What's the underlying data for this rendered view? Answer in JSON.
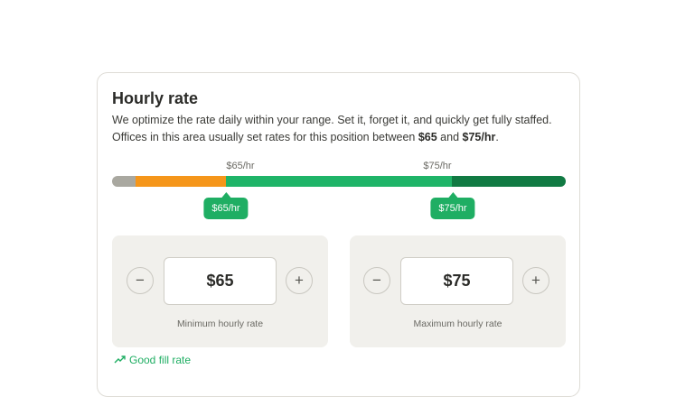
{
  "card": {
    "title": "Hourly rate",
    "desc_line1": "We optimize the rate daily within your range. Set it, forget it, and quickly get fully staffed.",
    "desc_line2_prefix": "Offices in this area usually set rates for this position between ",
    "desc_low": "$65",
    "desc_and": " and ",
    "desc_high": "$75/hr",
    "desc_end": "."
  },
  "range": {
    "tick_low": "$65/hr",
    "tick_high": "$75/hr",
    "pin_low": "$65/hr",
    "pin_high": "$75/hr",
    "colors": {
      "gray": "#a9a8a0",
      "orange": "#f5961a",
      "green": "#1fb468",
      "dark_green": "#117a43"
    }
  },
  "min_panel": {
    "decrement": "−",
    "increment": "+",
    "value": "$65",
    "caption": "Minimum hourly rate"
  },
  "max_panel": {
    "decrement": "−",
    "increment": "+",
    "value": "$75",
    "caption": "Maximum hourly rate"
  },
  "footer": {
    "link": "Good fill rate"
  }
}
